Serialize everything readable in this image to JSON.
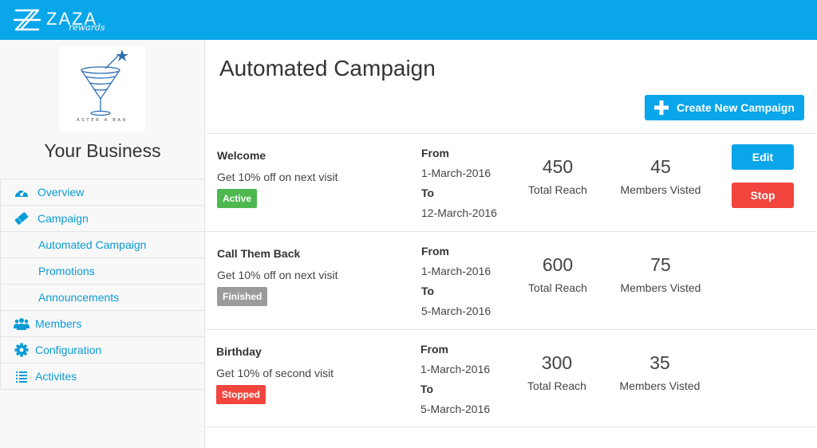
{
  "brand": {
    "name": "ZAZA",
    "sub": "rewards"
  },
  "sidebar": {
    "business_name": "Your Business",
    "logo_text": "ASTER A BAR",
    "nav": [
      {
        "label": "Overview",
        "icon": "dashboard-icon"
      },
      {
        "label": "Campaign",
        "icon": "ticket-icon"
      },
      {
        "label": "Automated Campaign"
      },
      {
        "label": "Promotions"
      },
      {
        "label": "Announcements"
      },
      {
        "label": "Members",
        "icon": "users-icon"
      },
      {
        "label": "Configuration",
        "icon": "gear-icon"
      },
      {
        "label": "Activites",
        "icon": "list-icon"
      }
    ]
  },
  "main": {
    "title": "Automated Campaign",
    "create_label": "Create New Campaign",
    "campaigns": [
      {
        "name": "Welcome",
        "desc": "Get 10% off on next visit",
        "status": "Active",
        "from_label": "From",
        "from": "1-March-2016",
        "to_label": "To",
        "to": "12-March-2016",
        "reach": "450",
        "reach_label": "Total Reach",
        "visited": "45",
        "visited_label": "Members Visted",
        "edit": "Edit",
        "stop": "Stop"
      },
      {
        "name": "Call Them Back",
        "desc": "Get 10% off on next visit",
        "status": "Finished",
        "from_label": "From",
        "from": "1-March-2016",
        "to_label": "To",
        "to": "5-March-2016",
        "reach": "600",
        "reach_label": "Total Reach",
        "visited": "75",
        "visited_label": "Members Visted"
      },
      {
        "name": "Birthday",
        "desc": "Get 10% of second visit",
        "status": "Stopped",
        "from_label": "From",
        "from": "1-March-2016",
        "to_label": "To",
        "to": "5-March-2016",
        "reach": "300",
        "reach_label": "Total Reach",
        "visited": "35",
        "visited_label": "Members Visted"
      }
    ]
  },
  "colors": {
    "accent": "#0aa6ea",
    "active": "#4db84f",
    "finished": "#9b9b9b",
    "stopped": "#f1453d"
  }
}
